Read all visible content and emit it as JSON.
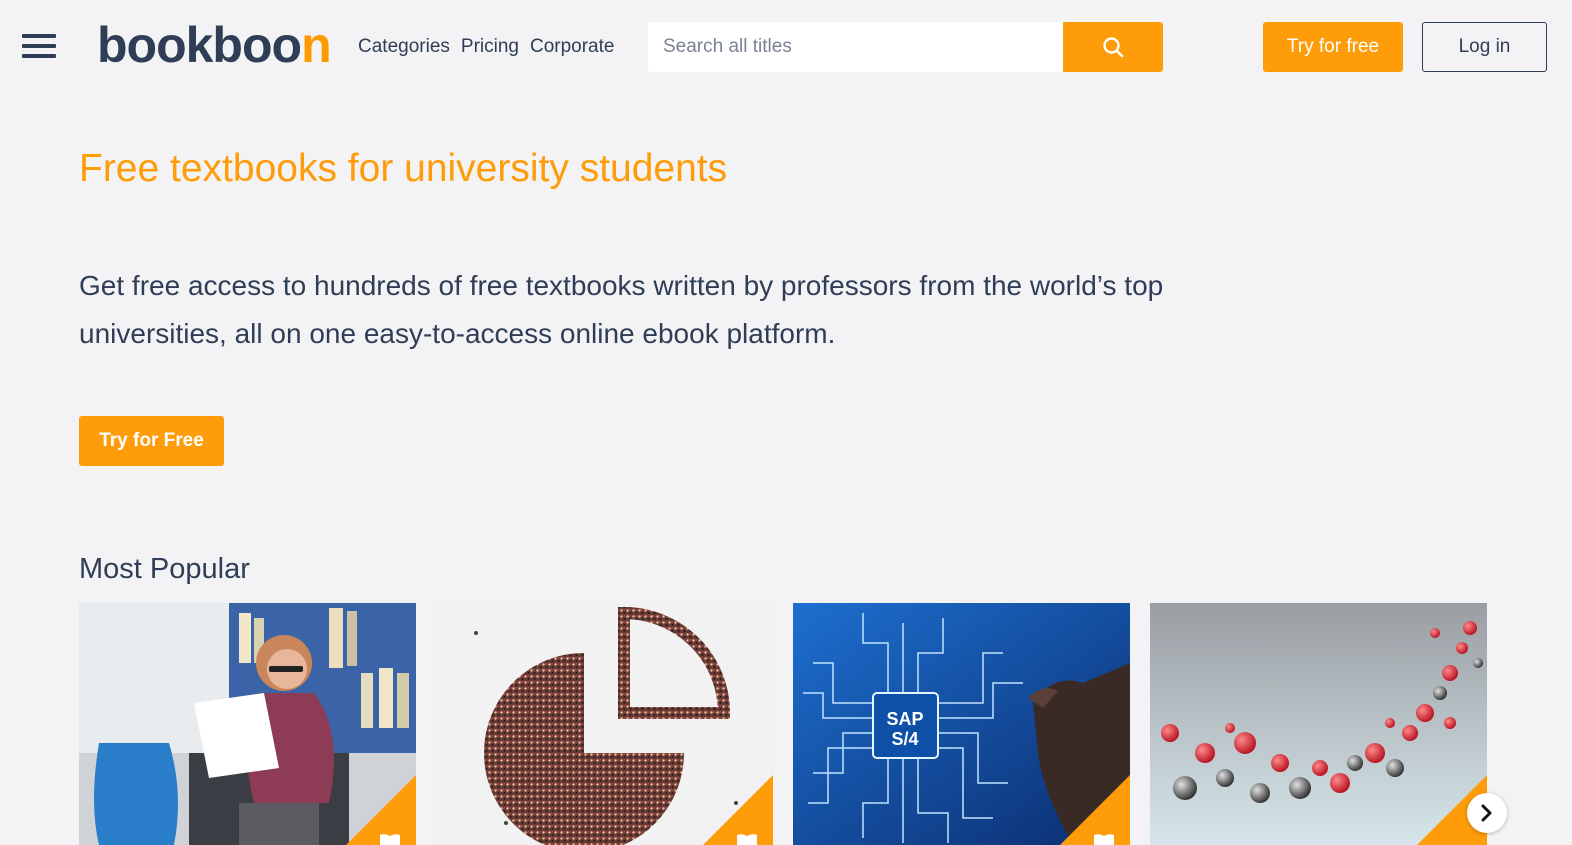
{
  "header": {
    "logo_main": "bookboo",
    "logo_accent": "n",
    "nav": [
      "Categories",
      "Pricing",
      "Corporate"
    ],
    "search_placeholder": "Search all titles",
    "try_label": "Try for free",
    "login_label": "Log in"
  },
  "hero": {
    "title": "Free textbooks for university students",
    "description": "Get free access to hundreds of free textbooks written by professors from the world’s top universities, all on one easy-to-access online ebook platform.",
    "cta_label": "Try for Free"
  },
  "popular": {
    "title": "Most Popular",
    "cards": [
      {
        "image": "student-reading-photo"
      },
      {
        "image": "crowd-pie-chart-photo"
      },
      {
        "image": "sap-chip-photo",
        "chip_text_1": "SAP",
        "chip_text_2": "S/4"
      },
      {
        "image": "molecule-spheres-photo"
      }
    ]
  },
  "colors": {
    "accent": "#ff9c0a",
    "text": "#2f3e56",
    "background": "#f3f3f5"
  },
  "icons": [
    "menu-icon",
    "search-icon",
    "book-icon",
    "chevron-right-icon"
  ]
}
